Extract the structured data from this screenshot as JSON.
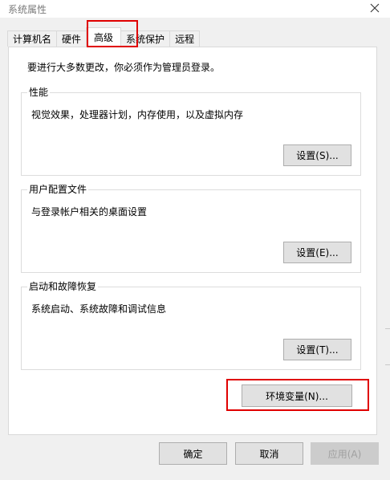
{
  "window": {
    "title": "系统属性",
    "close_glyph": "✕"
  },
  "tabs": [
    {
      "label": "计算机名",
      "active": false
    },
    {
      "label": "硬件",
      "active": false
    },
    {
      "label": "高级",
      "active": true
    },
    {
      "label": "系统保护",
      "active": false
    },
    {
      "label": "远程",
      "active": false
    }
  ],
  "advanced": {
    "notice": "要进行大多数更改，你必须作为管理员登录。",
    "performance": {
      "label": "性能",
      "description": "视觉效果，处理器计划，内存使用，以及虚拟内存",
      "button": "设置(S)..."
    },
    "user_profiles": {
      "label": "用户配置文件",
      "description": "与登录帐户相关的桌面设置",
      "button": "设置(E)..."
    },
    "startup_recovery": {
      "label": "启动和故障恢复",
      "description": "系统启动、系统故障和调试信息",
      "button": "设置(T)..."
    },
    "env_vars_button": "环境变量(N)..."
  },
  "footer": {
    "ok": "确定",
    "cancel": "取消",
    "apply": "应用(A)"
  },
  "colors": {
    "highlight": "#e00000",
    "dialog_background": "#f0f0f0",
    "button_face": "#e1e1e1"
  }
}
